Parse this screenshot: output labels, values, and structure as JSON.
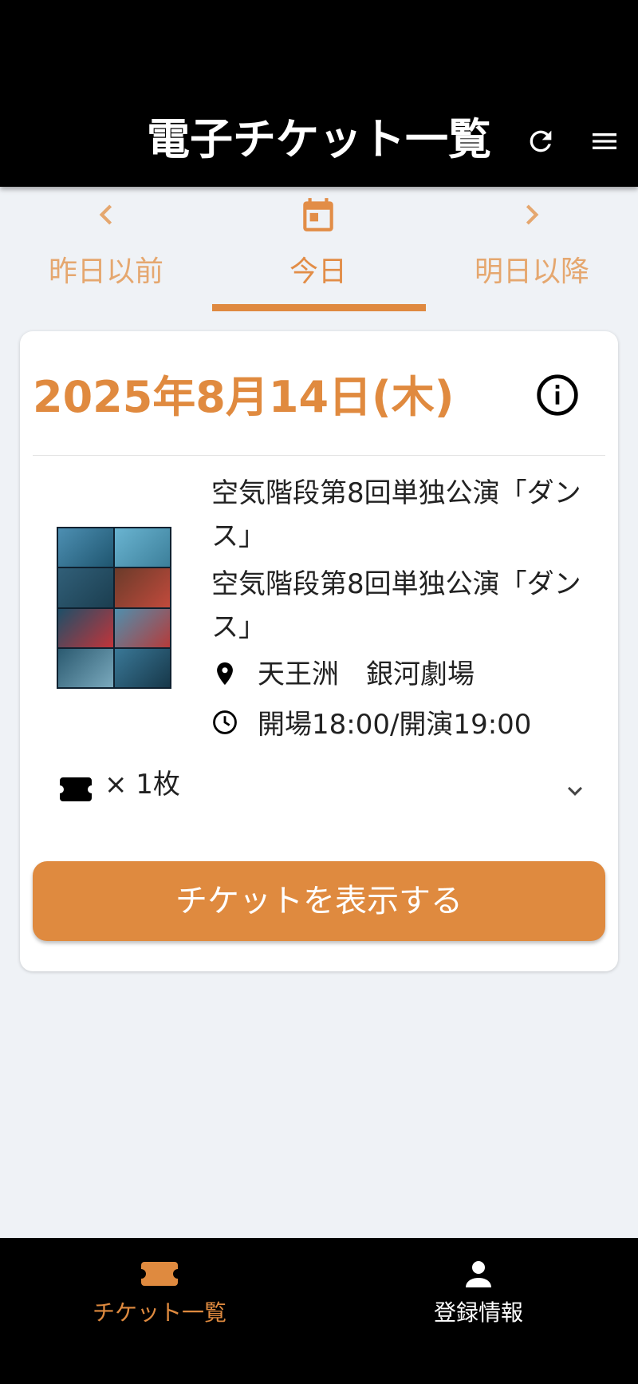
{
  "header": {
    "title": "電子チケット一覧",
    "refresh_icon": "refresh-icon",
    "menu_icon": "menu-icon"
  },
  "date_nav": {
    "items": [
      {
        "label": "昨日以前",
        "icon": "chevron-left-icon"
      },
      {
        "label": "今日",
        "icon": "calendar-icon"
      },
      {
        "label": "明日以降",
        "icon": "chevron-right-icon"
      }
    ],
    "active_index": 1
  },
  "card": {
    "date": "2025年8月14日(木)",
    "event_title": "空気階段第8回単独公演「ダンス」",
    "event_subtitle": "空気階段第8回単独公演「ダンス」",
    "venue": "天王洲　銀河劇場",
    "time": "開場18:00/開演19:00",
    "quantity": "× 1枚",
    "show_button": "チケットを表示する"
  },
  "bottom_nav": {
    "items": [
      {
        "label": "チケット一覧",
        "icon": "ticket-icon"
      },
      {
        "label": "登録情報",
        "icon": "person-icon"
      }
    ],
    "active_index": 0
  },
  "colors": {
    "accent": "#df8a3f",
    "header_bg": "#000000",
    "page_bg": "#eff2f6"
  }
}
